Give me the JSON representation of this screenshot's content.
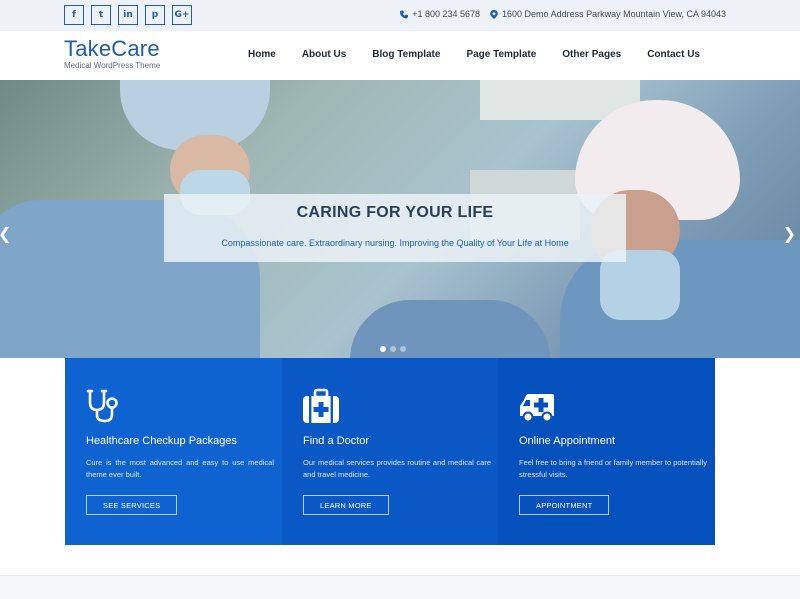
{
  "topbar": {
    "social": [
      {
        "icon": "facebook-icon",
        "glyph": "f"
      },
      {
        "icon": "twitter-icon",
        "glyph": "t"
      },
      {
        "icon": "linkedin-icon",
        "glyph": "in"
      },
      {
        "icon": "pinterest-icon",
        "glyph": "p"
      },
      {
        "icon": "google-plus-icon",
        "glyph": "G+"
      }
    ],
    "phone": "+1 800 234 5678",
    "address": "1600 Demo Address Parkway Mountain View, CA 94043"
  },
  "header": {
    "logo_name": "TakeCare",
    "logo_tagline": "Medical WordPress Theme",
    "nav": [
      "Home",
      "About Us",
      "Blog Template",
      "Page Template",
      "Other Pages",
      "Contact Us"
    ]
  },
  "hero": {
    "title": "CARING FOR YOUR LIFE",
    "subtitle": "Compassionate care. Extraordinary nursing. Improving the Quality of Your Life at Home",
    "slide_count": 3,
    "active_slide": 1
  },
  "cards": [
    {
      "icon": "stethoscope-icon",
      "title": "Healthcare Checkup Packages",
      "text": "Cure is the most advanced and easy to use medical theme ever built.",
      "button": "SEE SERVICES"
    },
    {
      "icon": "first-aid-kit-icon",
      "title": "Find a Doctor",
      "text": "Our medical services provides routine and medical care and travel medicine.",
      "button": "LEARN MORE"
    },
    {
      "icon": "ambulance-icon",
      "title": "Online Appointment",
      "text": "Feel free to bring a friend or family member to potentially stressful visits.",
      "button": "APPOINTMENT"
    }
  ],
  "colors": {
    "brand": "#1f5ea8",
    "card1": "#0f63d1",
    "card2": "#0a58c6",
    "card3": "#0450bd"
  }
}
